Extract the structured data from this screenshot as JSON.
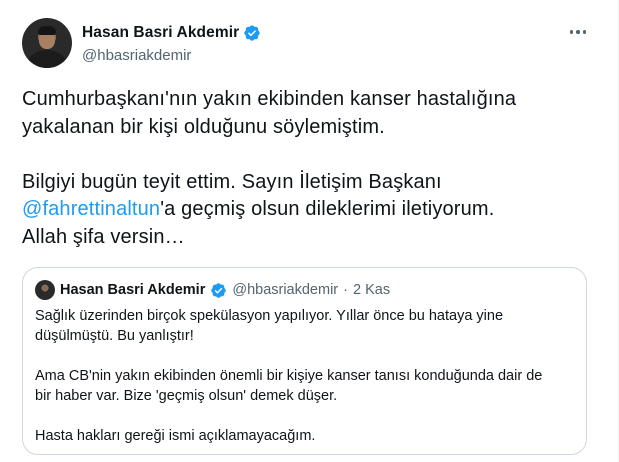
{
  "tweet": {
    "author_name": "Hasan Basri Akdemir",
    "author_handle": "@hbasriakdemir",
    "verified_icon": "verified-badge-icon",
    "more_icon": "more-options-icon",
    "text_line1": "Cumhurbaşkanı'nın yakın ekibinden kanser hastalığına",
    "text_line2": "yakalanan bir kişi olduğunu söylemiştim.",
    "text_line3": "Bilgiyi bugün teyit ettim. Sayın İletişim Başkanı",
    "mention": "@fahrettinaltun",
    "text_line4_rest": "'a geçmiş olsun dileklerimi iletiyorum.",
    "text_line5": "Allah şifa versin…"
  },
  "quote": {
    "author_name": "Hasan Basri Akdemir",
    "author_handle": "@hbasriakdemir",
    "separator": "·",
    "date": "2 Kas",
    "line1": "Sağlık üzerinden birçok spekülasyon yapılıyor. Yıllar önce bu hataya yine",
    "line2": "düşülmüştü. Bu yanlıştır!",
    "line3": "Ama CB'nin yakın ekibinden önemli bir kişiye kanser tanısı konduğunda dair de",
    "line4": "bir haber var. Bize 'geçmiş olsun' demek düşer.",
    "line5": "Hasta hakları gereği ismi açıklamayacağım."
  },
  "colors": {
    "text": "#0f1419",
    "secondary": "#536471",
    "link": "#1d9bf0",
    "border": "#cfd9de"
  }
}
